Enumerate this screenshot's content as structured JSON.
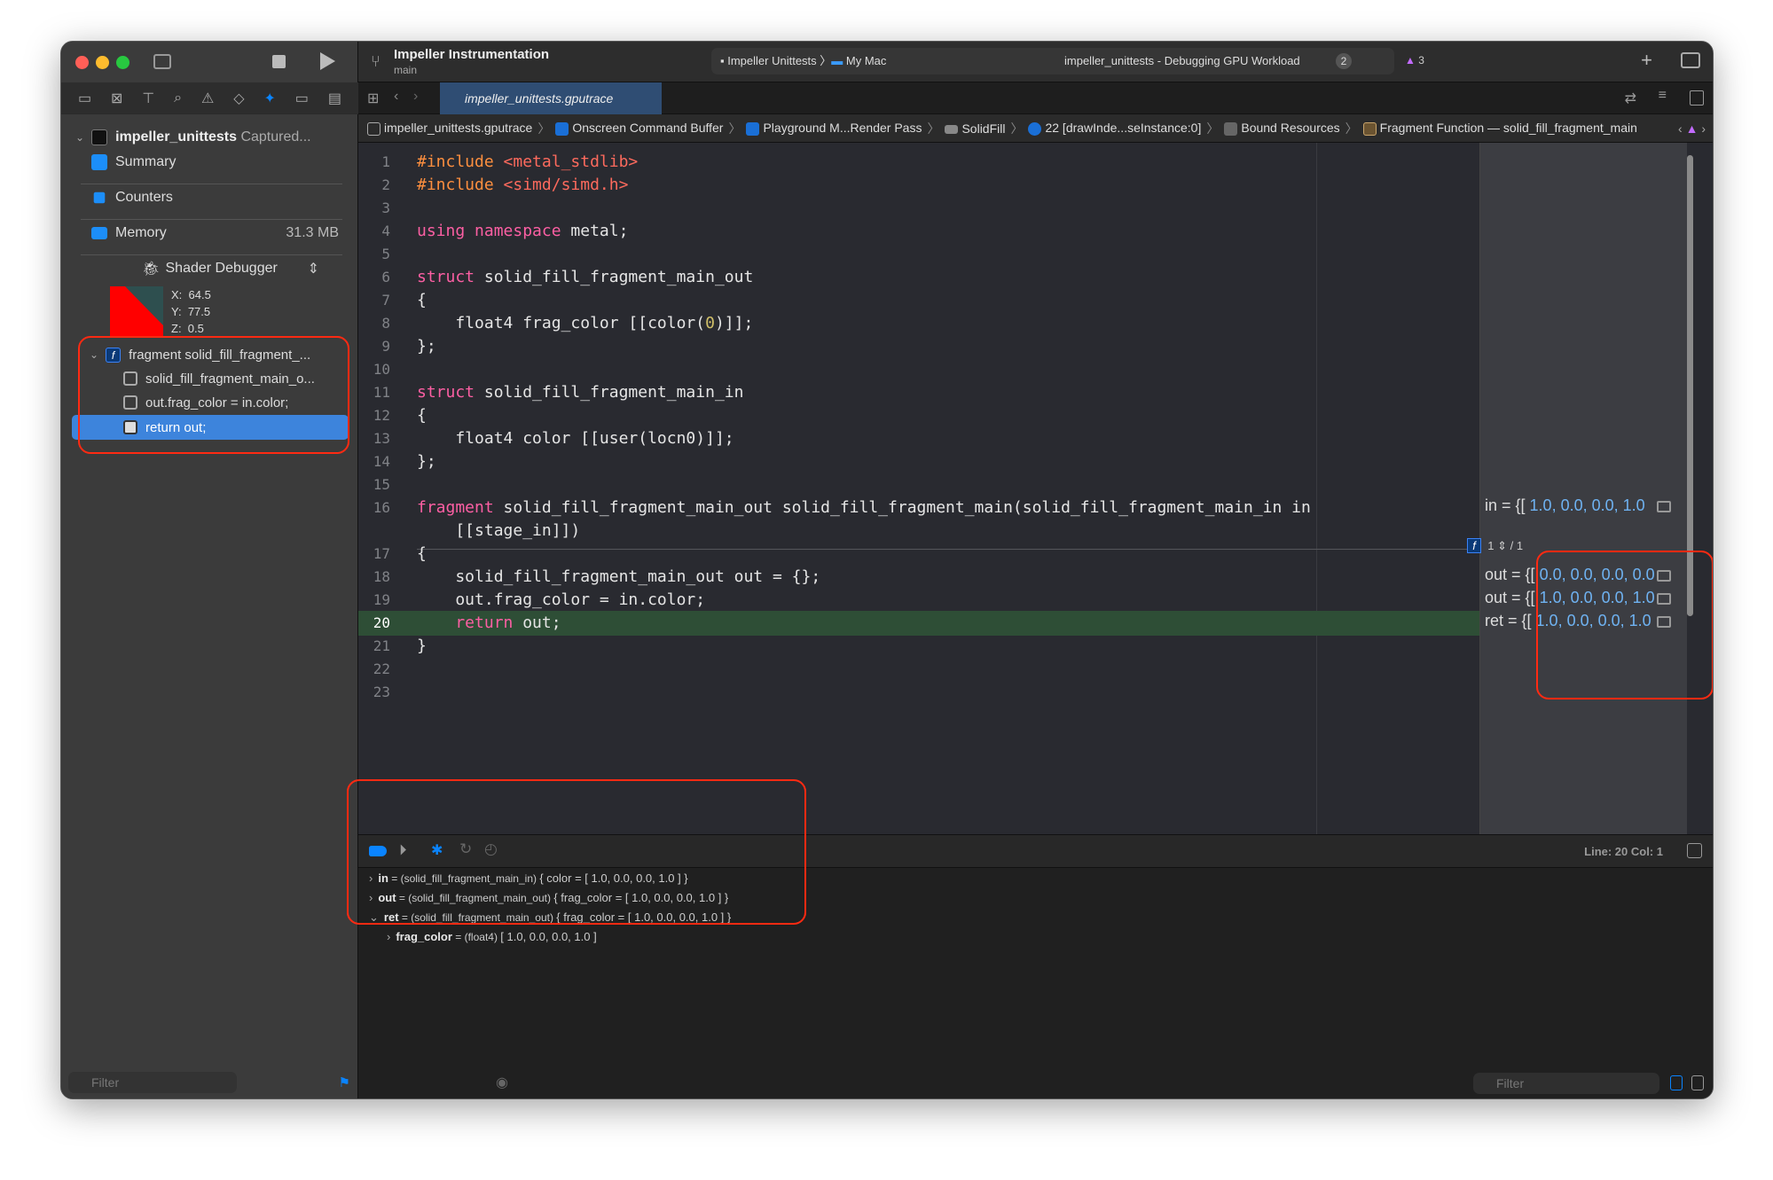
{
  "window": {
    "project": "Impeller Instrumentation",
    "branch": "main",
    "scheme": "Impeller Unittests",
    "destination": "My Mac",
    "activity": "impeller_unittests - Debugging GPU Workload",
    "activity_badge": "2",
    "warning_count": "3"
  },
  "tab": {
    "label": "impeller_unittests.gputrace"
  },
  "breadcrumbs": [
    "impeller_unittests.gputrace",
    "Onscreen Command Buffer",
    "Playground M...Render Pass",
    "SolidFill",
    "22 [drawInde...seInstance:0]",
    "Bound Resources",
    "Fragment Function — solid_fill_fragment_main"
  ],
  "sidebar": {
    "root": {
      "name": "impeller_unittests",
      "status": "Captured..."
    },
    "items": [
      {
        "label": "Summary"
      },
      {
        "label": "Counters"
      },
      {
        "label": "Memory",
        "value": "31.3 MB"
      }
    ],
    "debugger_label": "Shader Debugger",
    "coords": {
      "x_label": "X:",
      "x": "64.5",
      "y_label": "Y:",
      "y": "77.5",
      "z_label": "Z:",
      "z": "0.5"
    },
    "tree": [
      {
        "label": "fragment solid_fill_fragment_..."
      },
      {
        "label": "solid_fill_fragment_main_o..."
      },
      {
        "label": "out.frag_color = in.color;"
      },
      {
        "label": "return out;"
      }
    ],
    "filter_placeholder": "Filter"
  },
  "editor": {
    "rows": [
      {
        "n": "1",
        "s": [
          [
            "pp",
            "#include "
          ],
          [
            "str",
            "<metal_stdlib>"
          ]
        ]
      },
      {
        "n": "2",
        "s": [
          [
            "pp",
            "#include "
          ],
          [
            "str",
            "<simd/simd.h>"
          ]
        ]
      },
      {
        "n": "3",
        "s": []
      },
      {
        "n": "4",
        "s": [
          [
            "kw",
            "using namespace "
          ],
          [
            "p",
            "metal;"
          ]
        ]
      },
      {
        "n": "5",
        "s": []
      },
      {
        "n": "6",
        "s": [
          [
            "kw",
            "struct "
          ],
          [
            "p",
            "solid_fill_fragment_main_out"
          ]
        ]
      },
      {
        "n": "7",
        "s": [
          [
            "p",
            "{"
          ]
        ]
      },
      {
        "n": "8",
        "s": [
          [
            "p",
            "    float4 frag_color [[color("
          ],
          [
            "num",
            "0"
          ],
          [
            "p",
            ")]];"
          ]
        ]
      },
      {
        "n": "9",
        "s": [
          [
            "p",
            "};"
          ]
        ]
      },
      {
        "n": "10",
        "s": []
      },
      {
        "n": "11",
        "s": [
          [
            "kw",
            "struct "
          ],
          [
            "p",
            "solid_fill_fragment_main_in"
          ]
        ]
      },
      {
        "n": "12",
        "s": [
          [
            "p",
            "{"
          ]
        ]
      },
      {
        "n": "13",
        "s": [
          [
            "p",
            "    float4 color [[user(locn0)]];"
          ]
        ]
      },
      {
        "n": "14",
        "s": [
          [
            "p",
            "};"
          ]
        ]
      },
      {
        "n": "15",
        "s": []
      },
      {
        "n": "16",
        "s": [
          [
            "kw",
            "fragment "
          ],
          [
            "p",
            "solid_fill_fragment_main_out solid_fill_fragment_main(solid_fill_fragment_main_in in"
          ]
        ]
      },
      {
        "n": "",
        "s": [
          [
            "p",
            "    [[stage_in]])"
          ]
        ]
      },
      {
        "n": "17",
        "s": [
          [
            "p",
            "{"
          ]
        ]
      },
      {
        "n": "18",
        "s": [
          [
            "p",
            "    solid_fill_fragment_main_out out = {};"
          ]
        ]
      },
      {
        "n": "19",
        "s": [
          [
            "p",
            "    out.frag_color = in.color;"
          ]
        ]
      },
      {
        "n": "20",
        "s": [
          [
            "kw",
            "    return "
          ],
          [
            "p",
            "out;"
          ]
        ],
        "current": true
      },
      {
        "n": "21",
        "s": [
          [
            "p",
            "}"
          ]
        ]
      },
      {
        "n": "22",
        "s": []
      },
      {
        "n": "23",
        "s": []
      }
    ],
    "function_picker": {
      "index": "1",
      "total": "/ 1"
    },
    "annotations": [
      {
        "name": "in = {[",
        "values": " 1.0, 0.0, 0.0, 1.0"
      },
      {
        "name": "out = {[",
        "values": " 0.0, 0.0, 0.0, 0.0"
      },
      {
        "name": "out = {[",
        "values": " 1.0, 0.0, 0.0, 1.0"
      },
      {
        "name": "ret = {[",
        "values": " 1.0, 0.0, 0.0, 1.0"
      }
    ]
  },
  "debug": {
    "cursor": "Line: 20  Col: 1",
    "variables": [
      {
        "name": "in",
        "type": " = (solid_fill_fragment_main_in) ",
        "value": "{ color = [ 1.0, 0.0, 0.0, 1.0 ] }",
        "expanded": false
      },
      {
        "name": "out",
        "type": " = (solid_fill_fragment_main_out) ",
        "value": "{ frag_color = [ 1.0, 0.0, 0.0, 1.0 ] }",
        "expanded": false
      },
      {
        "name": "ret",
        "type": " = (solid_fill_fragment_main_out) ",
        "value": "{ frag_color = [ 1.0, 0.0, 0.0, 1.0 ] }",
        "expanded": true
      },
      {
        "name": "frag_color",
        "type": " = (float4) ",
        "value": "[ 1.0, 0.0, 0.0, 1.0 ]",
        "expanded": false
      }
    ],
    "filter_placeholder": "Filter"
  },
  "colors": {
    "accent": "#0a84ff",
    "highlight": "#2e4e36",
    "annotation_box": "#ff2a12",
    "selected": "#3d84dc"
  }
}
